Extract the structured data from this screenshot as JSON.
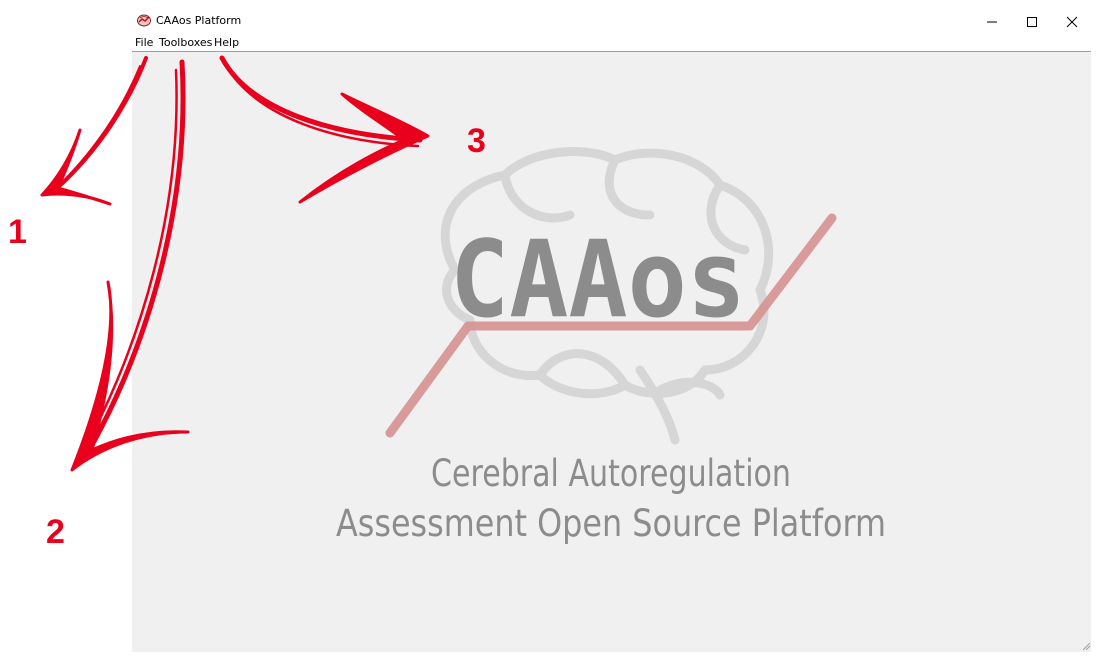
{
  "window": {
    "title": "CAAos Platform"
  },
  "menu": {
    "items": [
      "File",
      "Toolboxes",
      "Help"
    ]
  },
  "logo": {
    "wordmark": "CAAos",
    "subtitle_line1": "Cerebral Autoregulation",
    "subtitle_line2": "Assessment Open Source Platform"
  },
  "annotations": {
    "labels": [
      "1",
      "2",
      "3"
    ],
    "color": "#e8001c"
  },
  "icons": {
    "app": "brain-icon",
    "minimize": "minimize-icon",
    "maximize": "maximize-icon",
    "close": "close-icon",
    "resize": "resize-grip-icon"
  },
  "colors": {
    "client_background": "#f0f0f0",
    "logo_gray": "#8c8c8c",
    "logo_line": "#d79595",
    "brain_outline": "#d6d6d6"
  }
}
